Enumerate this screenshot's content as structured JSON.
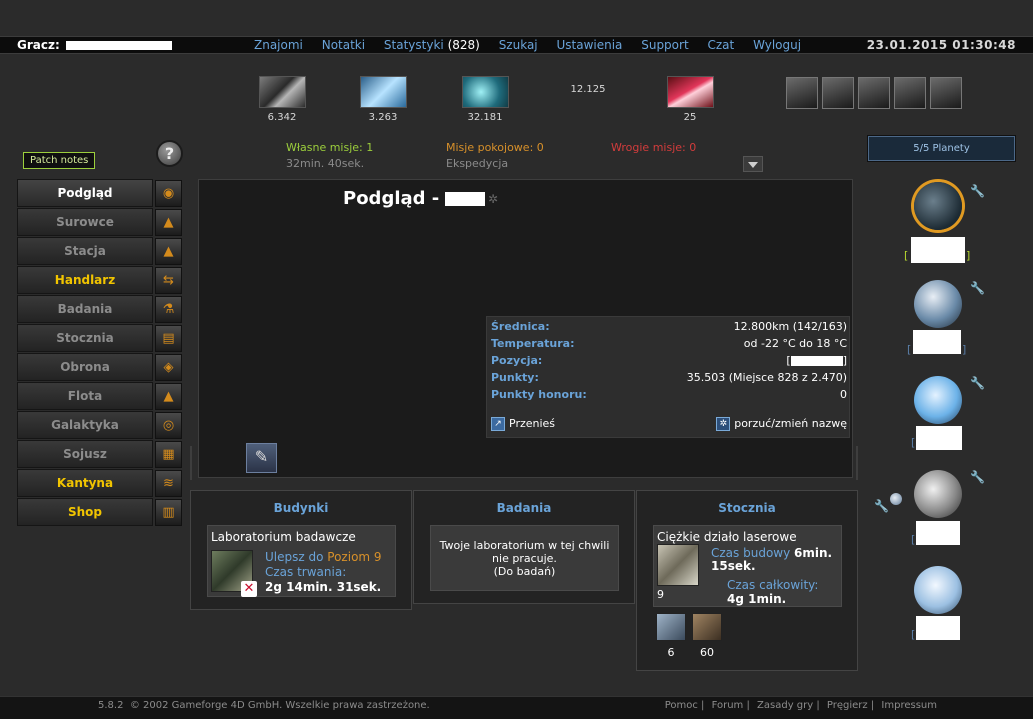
{
  "header": {
    "player_label": "Gracz:",
    "menu": [
      "Znajomi",
      "Notatki",
      "Statystyki",
      "Szukaj",
      "Ustawienia",
      "Support",
      "Czat",
      "Wyloguj"
    ],
    "stat_count": "(828)",
    "datetime": "23.01.2015 01:30:48"
  },
  "resources": [
    {
      "name": "metal-icon",
      "value": "6.342"
    },
    {
      "name": "crystal-icon",
      "value": "3.263"
    },
    {
      "name": "deuterium-icon",
      "value": "32.181"
    },
    {
      "name": "energy-value",
      "value": "12.125"
    },
    {
      "name": "dark-matter-icon",
      "value": "25"
    }
  ],
  "patch_notes": "Patch notes",
  "help_icon": "?",
  "missions": {
    "own": "Własne misje: 1",
    "own_timer": "32min. 40sek.",
    "peace": "Misje pokojowe: 0",
    "peace_sub": "Ekspedycja",
    "hostile": "Wrogie misje: 0"
  },
  "sidebar": {
    "items": [
      {
        "label": "Podgląd",
        "icon": "overview-icon"
      },
      {
        "label": "Surowce",
        "icon": "resources-icon"
      },
      {
        "label": "Stacja",
        "icon": "station-icon"
      },
      {
        "label": "Handlarz",
        "icon": "trader-icon"
      },
      {
        "label": "Badania",
        "icon": "research-icon"
      },
      {
        "label": "Stocznia",
        "icon": "shipyard-icon"
      },
      {
        "label": "Obrona",
        "icon": "defense-icon"
      },
      {
        "label": "Flota",
        "icon": "fleet-icon"
      },
      {
        "label": "Galaktyka",
        "icon": "galaxy-icon"
      },
      {
        "label": "Sojusz",
        "icon": "alliance-icon"
      },
      {
        "label": "Kantyna",
        "icon": "cantina-icon"
      },
      {
        "label": "Shop",
        "icon": "shop-icon"
      }
    ]
  },
  "overview": {
    "title": "Podgląd -",
    "diameter_label": "Średnica:",
    "diameter_value": "12.800km (142/163)",
    "temperature_label": "Temperatura:",
    "temperature_value": "od -22 °C do 18 °C",
    "position_label": "Pozycja:",
    "points_label": "Punkty:",
    "points_value": "35.503 (Miejsce 828 z 2.470)",
    "honor_label": "Punkty honoru:",
    "honor_value": "0",
    "relocate": "Przenieś",
    "abandon": "porzuć/zmień nazwę"
  },
  "buildings": {
    "title": "Budynki",
    "item": "Laboratorium badawcze",
    "upgrade": "Ulepsz do",
    "level": "Poziom 9",
    "duration_label": "Czas trwania:",
    "duration": "2g 14min. 31sek."
  },
  "research": {
    "title": "Badania",
    "msg1": "Twoje laboratorium w tej chwili",
    "msg2": "nie pracuje.",
    "msg3": "(Do badań)"
  },
  "shipyard": {
    "title": "Stocznia",
    "item": "Ciężkie działo laserowe",
    "build_time_label": "Czas budowy",
    "build_time": "6min.",
    "build_time2": "15sek.",
    "total_label": "Czas całkowity:",
    "total": "4g 1min.",
    "count": "9",
    "queue": [
      "6",
      "60"
    ]
  },
  "planets": {
    "header": "5/5 Planety"
  },
  "footer": {
    "version": "5.8.2",
    "copyright": "© 2002 Gameforge 4D GmbH. Wszelkie prawa zastrzeżone.",
    "links": [
      "Pomoc",
      "Forum",
      "Zasady gry",
      "Pręgierz",
      "Impressum"
    ]
  },
  "colors": {
    "accent_blue": "#6aa3d8",
    "highlight_yellow": "#f1c400",
    "own_missions": "#9ccf3c",
    "peace_missions": "#d7902a",
    "hostile_missions": "#d23c3c"
  }
}
